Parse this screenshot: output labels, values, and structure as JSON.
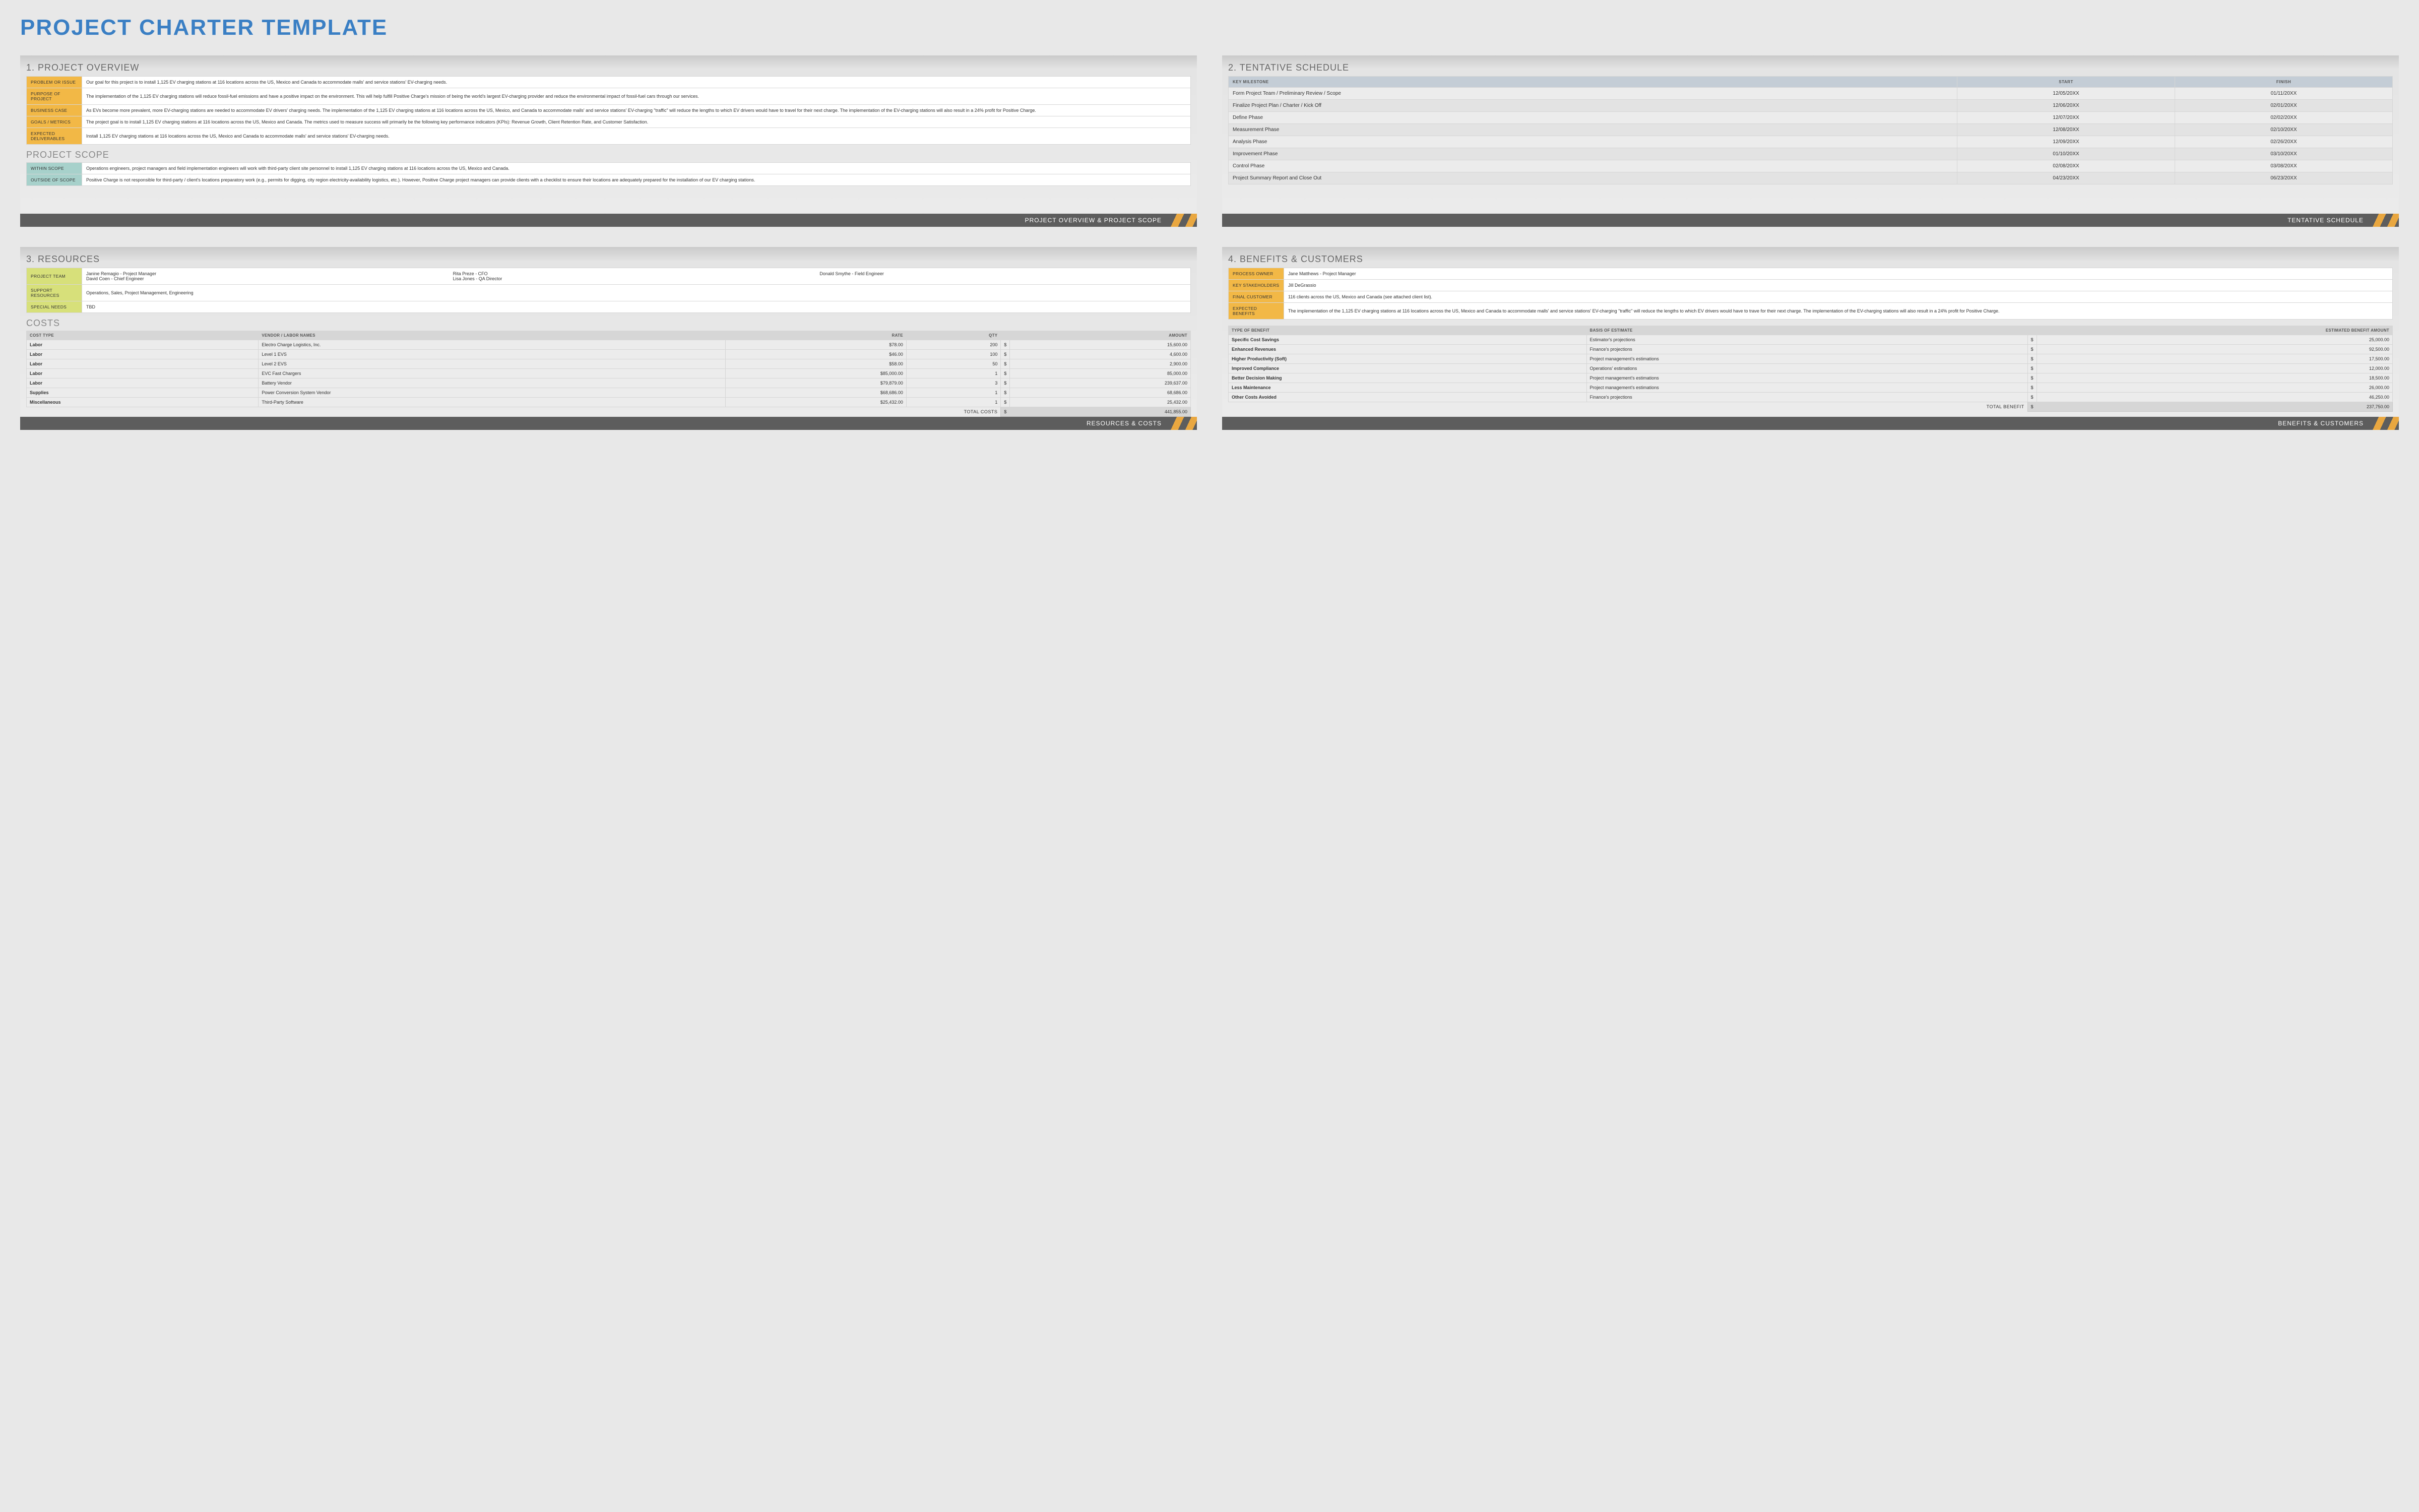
{
  "title": "PROJECT CHARTER TEMPLATE",
  "panels": {
    "overview": {
      "heading": "1. PROJECT OVERVIEW",
      "rows": [
        {
          "label": "PROBLEM OR ISSUE",
          "text": "Our goal for this project is to install 1,125 EV charging stations at 116  locations across the US, Mexico and Canada to accommodate malls' and service stations' EV-charging needs."
        },
        {
          "label": "PURPOSE OF PROJECT",
          "text": "The implementation of the 1,125 EV charging stations will reduce fossil-fuel emissions and have a positive impact on the environment. This will help fulfill Positive Charge's mission of being the world's largest EV-charging provider and reduce the environmental impact of fossil-fuel cars through our services."
        },
        {
          "label": "BUSINESS CASE",
          "text": "As EVs become more prevalent, more EV-charging stations are needed to accommodate EV drivers' charging needs. The implementation of the 1,125 EV charging stations at 116  locations across the US, Mexico, and Canada to accommodate malls' and service stations' EV-charging \"traffic\" will reduce the lengths to which EV drivers would have to travel for their next charge. The implementation of the EV-charging stations will also result in a 24% profit for Positive Charge."
        },
        {
          "label": "GOALS / METRICS",
          "text": "The project goal is to install 1,125 EV charging stations at 116  locations across the US, Mexico and Canada. The metrics used to measure success will primarily be the following key performance indicators (KPIs): Revenue Growth, Client Retention Rate, and Customer Satisfaction."
        },
        {
          "label": "EXPECTED DELIVERABLES",
          "text": "Install 1,125 EV charging stations at 116  locations across the US, Mexico and Canada to accommodate malls' and service stations' EV-charging needs."
        }
      ],
      "scope_heading": "PROJECT SCOPE",
      "scope_rows": [
        {
          "label": "WITHIN SCOPE",
          "text": "Operations engineers, project managers and field implementation engineers will work with third-party client site personnel to install 1,125 EV charging stations at 116  locations across the US, Mexico and Canada."
        },
        {
          "label": "OUTSIDE OF SCOPE",
          "text": "Positive Charge is not responsible for third-party / client's locations preparatory work (e.g., permits for digging, city region electricity-availability logistics, etc.). However, Positive Charge project managers can provide clients with a checklist to ensure their locations are adequately prepared for the installation of our EV charging stations."
        }
      ],
      "footer": "PROJECT OVERVIEW & PROJECT SCOPE"
    },
    "schedule": {
      "heading": "2. TENTATIVE SCHEDULE",
      "columns": [
        "KEY MILESTONE",
        "START",
        "FINISH"
      ],
      "rows": [
        {
          "milestone": "Form Project Team / Preliminary Review / Scope",
          "start": "12/05/20XX",
          "finish": "01/11/20XX"
        },
        {
          "milestone": "Finalize Project Plan / Charter / Kick Off",
          "start": "12/06/20XX",
          "finish": "02/01/20XX"
        },
        {
          "milestone": "Define Phase",
          "start": "12/07/20XX",
          "finish": "02/02/20XX"
        },
        {
          "milestone": "Measurement Phase",
          "start": "12/08/20XX",
          "finish": "02/10/20XX"
        },
        {
          "milestone": "Analysis Phase",
          "start": "12/09/20XX",
          "finish": "02/26/20XX"
        },
        {
          "milestone": "Improvement Phase",
          "start": "01/10/20XX",
          "finish": "03/10/20XX"
        },
        {
          "milestone": "Control Phase",
          "start": "02/08/20XX",
          "finish": "03/08/20XX"
        },
        {
          "milestone": "Project Summary Report and Close Out",
          "start": "04/23/20XX",
          "finish": "06/23/20XX"
        }
      ],
      "footer": "TENTATIVE SCHEDULE"
    },
    "resources": {
      "heading": "3. RESOURCES",
      "team": {
        "label": "PROJECT TEAM",
        "col1": [
          "Janine Remagio - Project Manager",
          "David Coen - Chief Engineer"
        ],
        "col2": [
          "Rita Preze - CFO",
          "Lisa Jones - QA Director"
        ],
        "col3": [
          "Donald Smythe - Field Engineer",
          ""
        ]
      },
      "support": {
        "label": "SUPPORT RESOURCES",
        "text": "Operations, Sales, Project Management, Engineering"
      },
      "special": {
        "label": "SPECIAL NEEDS",
        "text": "TBD"
      },
      "costs_heading": "COSTS",
      "cost_columns": [
        "COST TYPE",
        "VENDOR / LABOR NAMES",
        "RATE",
        "QTY",
        "AMOUNT"
      ],
      "cost_rows": [
        {
          "type": "Labor",
          "vendor": "Electro Charge Logistics, Inc.",
          "rate": "$78.00",
          "qty": "200",
          "amount": "15,600.00"
        },
        {
          "type": "Labor",
          "vendor": "Level 1 EVS",
          "rate": "$46.00",
          "qty": "100",
          "amount": "4,600.00"
        },
        {
          "type": "Labor",
          "vendor": "Level 2 EVS",
          "rate": "$58.00",
          "qty": "50",
          "amount": "2,900.00"
        },
        {
          "type": "Labor",
          "vendor": "EVC Fast Chargers",
          "rate": "$85,000.00",
          "qty": "1",
          "amount": "85,000.00"
        },
        {
          "type": "Labor",
          "vendor": "Battery Vendor",
          "rate": "$79,879.00",
          "qty": "3",
          "amount": "239,637.00"
        },
        {
          "type": "Supplies",
          "vendor": "Power Conversion System Vendor",
          "rate": "$68,686.00",
          "qty": "1",
          "amount": "68,686.00"
        },
        {
          "type": "Miscellaneous",
          "vendor": "Third-Party Software",
          "rate": "$25,432.00",
          "qty": "1",
          "amount": "25,432.00"
        }
      ],
      "total_label": "TOTAL COSTS",
      "total_amount": "441,855.00",
      "footer": "RESOURCES & COSTS"
    },
    "benefits": {
      "heading": "4. BENEFITS & CUSTOMERS",
      "rows": [
        {
          "label": "PROCESS OWNER",
          "text": "Jane Matthews - Project Manager"
        },
        {
          "label": "KEY STAKEHOLDERS",
          "text": "Jill DeGrassio"
        },
        {
          "label": "FINAL CUSTOMER",
          "text": "116  clients across the US, Mexico and Canada (see attached client list)."
        },
        {
          "label": "EXPECTED BENEFITS",
          "text": "The implementation of the 1,125 EV charging stations at 116  locations across the US, Mexico and Canada to accommodate malls' and service stations' EV-charging \"traffic\" will reduce the lengths to which EV drivers would have to trave for their next charge. The implementation of the EV-charging stations will also result in a 24% profit for Positive Charge."
        }
      ],
      "benefit_columns": [
        "TYPE OF BENEFIT",
        "BASIS OF ESTIMATE",
        "ESTIMATED BENEFIT AMOUNT"
      ],
      "benefit_rows": [
        {
          "type": "Specific Cost Savings",
          "basis": "Estimator's projections",
          "amount": "25,000.00"
        },
        {
          "type": "Enhanced Revenues",
          "basis": "Finance's projections",
          "amount": "92,500.00"
        },
        {
          "type": "Higher Productivity (Soft)",
          "basis": "Project management's estimations",
          "amount": "17,500.00"
        },
        {
          "type": "Improved Compliance",
          "basis": "Operations' estimations",
          "amount": "12,000.00"
        },
        {
          "type": "Better Decision Making",
          "basis": "Project management's estimations",
          "amount": "18,500.00"
        },
        {
          "type": "Less Maintenance",
          "basis": "Project management's estimations",
          "amount": "26,000.00"
        },
        {
          "type": "Other Costs Avoided",
          "basis": "Finance's projections",
          "amount": "46,250.00"
        }
      ],
      "total_label": "TOTAL BENEFIT",
      "total_amount": "237,750.00",
      "footer": "BENEFITS & CUSTOMERS"
    }
  }
}
